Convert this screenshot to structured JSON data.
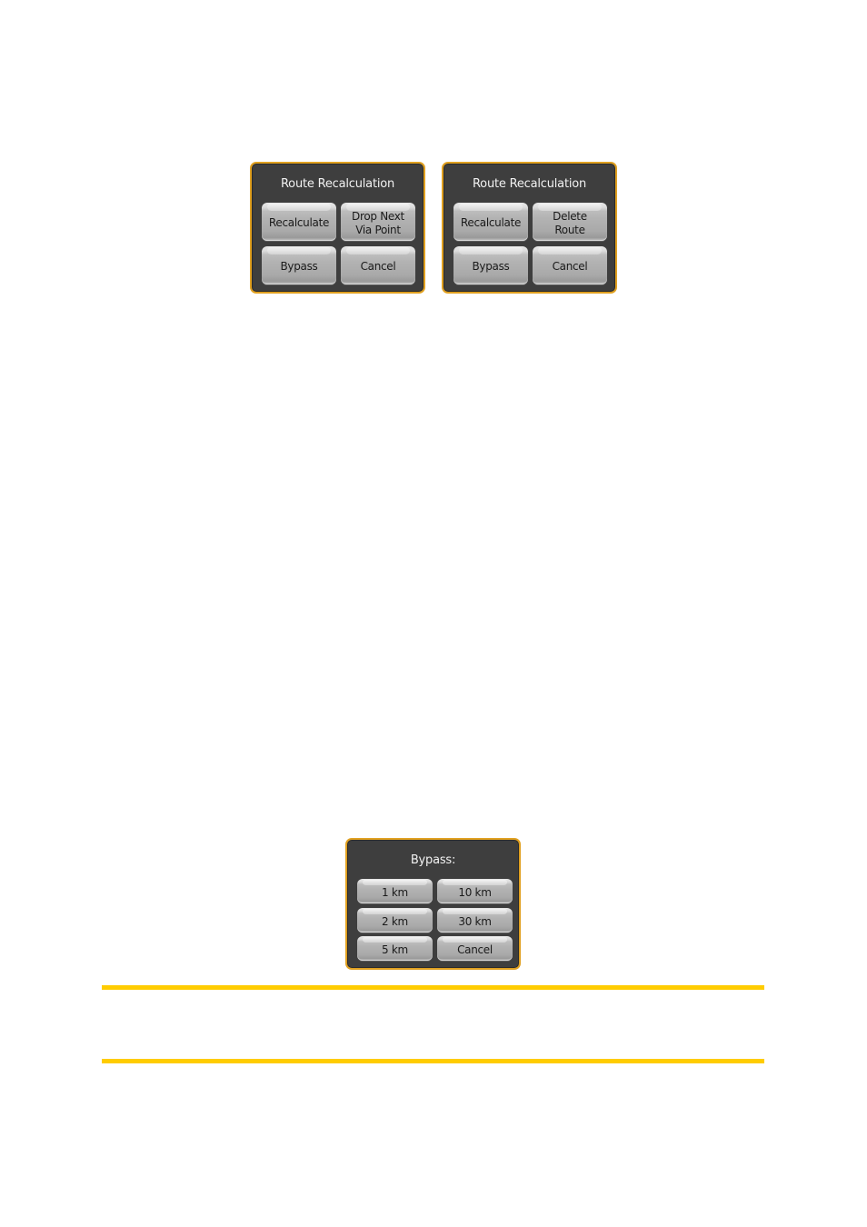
{
  "figures": {
    "route_recalculation_via_point": {
      "title": "Route Recalculation",
      "buttons": [
        "Recalculate",
        "Drop Next\nVia Point",
        "Bypass",
        "Cancel"
      ]
    },
    "route_recalculation_delete": {
      "title": "Route Recalculation",
      "buttons": [
        "Recalculate",
        "Delete\nRoute",
        "Bypass",
        "Cancel"
      ]
    },
    "bypass": {
      "title": "Bypass:",
      "buttons": [
        "1 km",
        "10 km",
        "2 km",
        "30 km",
        "5 km",
        "Cancel"
      ]
    }
  },
  "colors": {
    "dialog_background": "#3e3e3e",
    "dialog_border": "#e0a020",
    "note_rule": "#ffcc00"
  }
}
